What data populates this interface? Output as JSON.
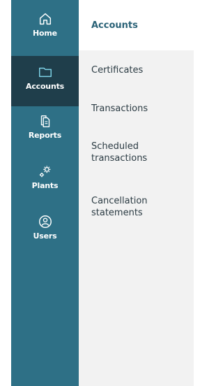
{
  "nav": {
    "items": [
      {
        "label": "Home",
        "icon": "home-icon"
      },
      {
        "label": "Accounts",
        "icon": "folder-icon",
        "active": true
      },
      {
        "label": "Reports",
        "icon": "document-icon"
      },
      {
        "label": "Plants",
        "icon": "gears-icon"
      },
      {
        "label": "Users",
        "icon": "user-circle-icon"
      }
    ]
  },
  "submenu": {
    "items": [
      {
        "label": "Accounts",
        "current": true
      },
      {
        "label": "Certificates"
      },
      {
        "label": "Transactions"
      },
      {
        "label": "Scheduled transactions"
      },
      {
        "label": "Cancellation statements"
      }
    ]
  },
  "colors": {
    "rail": "#2e7086",
    "rail_active": "#1f3e4b",
    "active_icon": "#7ed2e6",
    "submenu_bg": "#f2f2f2",
    "current_text": "#2a6277"
  }
}
